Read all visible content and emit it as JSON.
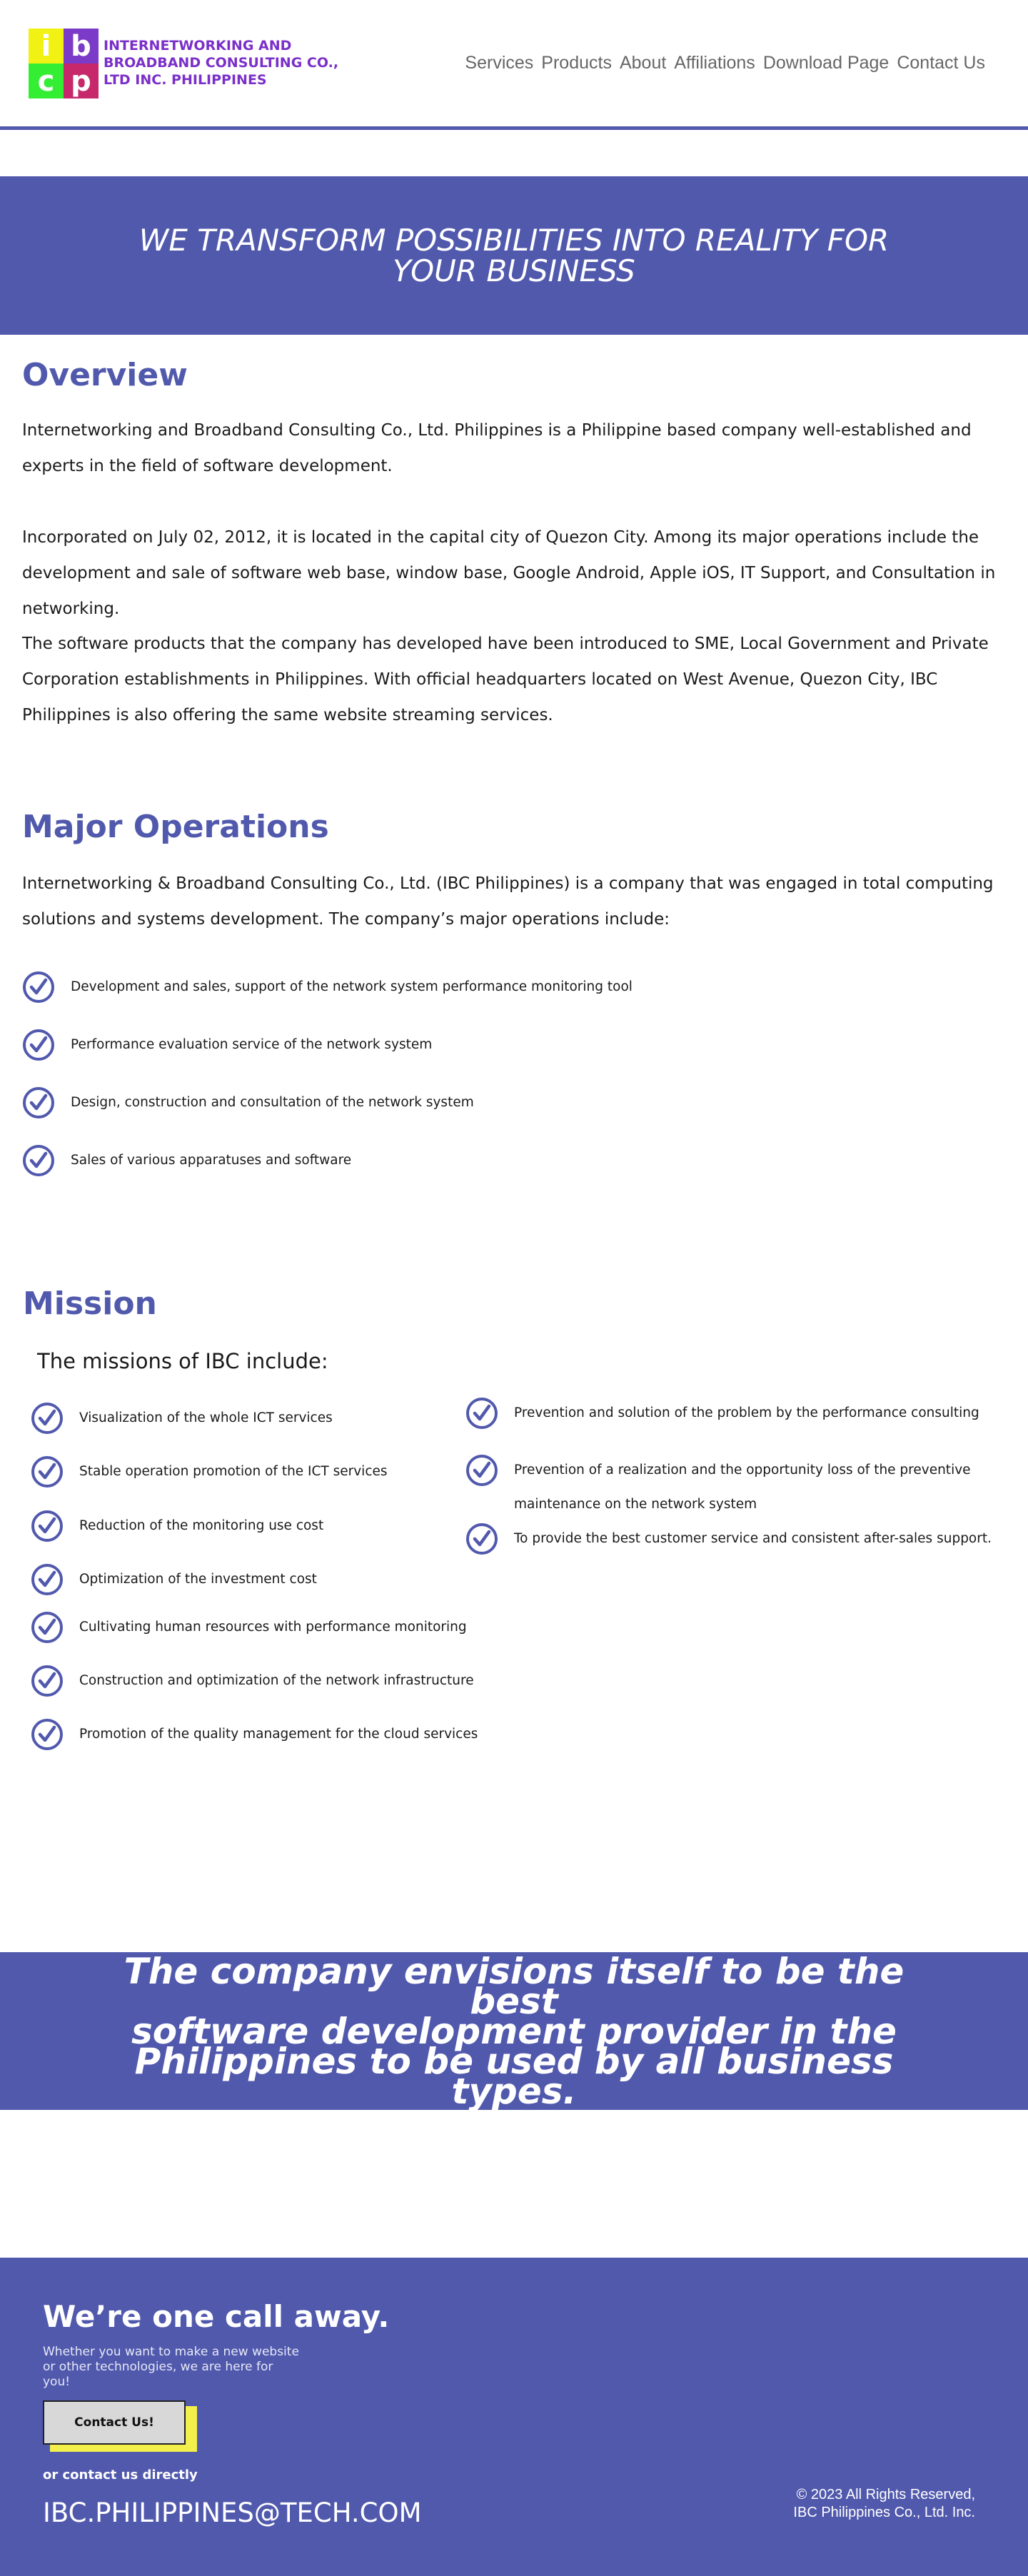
{
  "header": {
    "logo_letters": [
      "i",
      "b",
      "c",
      "p"
    ],
    "company_name_line1": "INTERNETWORKING AND",
    "company_name_line2": "BROADBAND CONSULTING CO.,",
    "company_name_line3": "LTD INC. PHILIPPINES",
    "nav": [
      "Services",
      "Products",
      "About",
      "Affiliations",
      "Download Page",
      "Contact Us"
    ]
  },
  "hero": {
    "line1": "WE TRANSFORM POSSIBILITIES INTO REALITY FOR",
    "line2": "YOUR BUSINESS"
  },
  "overview": {
    "title": "Overview",
    "p1": "Internetworking and Broadband Consulting Co., Ltd. Philippines is a Philippine based company well-established and experts in the field of software development.",
    "p2": "Incorporated on July 02, 2012, it is located in the capital city of Quezon City. Among its major operations include the development and sale of software web base, window base, Google Android, Apple iOS, IT Support, and Consultation in networking.",
    "p3": "The software products that the company has developed have been introduced to SME, Local Government and Private Corporation establishments in Philippines. With official headquarters located on West Avenue, Quezon City, IBC Philippines is also offering the same website streaming services."
  },
  "operations": {
    "title": "Major Operations",
    "intro": "Internetworking & Broadband Consulting Co., Ltd. (IBC Philippines) is a company that was engaged in total computing solutions and systems development. The company’s major operations include:",
    "items": [
      "Development and sales, support of the network system performance monitoring tool",
      "Performance evaluation service of the network system",
      "Design, construction and consultation of the network system",
      "Sales of various apparatuses and software"
    ]
  },
  "mission": {
    "title": "Mission",
    "subtitle": "The missions of IBC include:",
    "left_items": [
      "Visualization of the whole ICT services",
      "Stable operation promotion of the ICT services",
      "Reduction of the monitoring use cost",
      "Optimization of the investment cost",
      "Cultivating human resources with performance monitoring",
      "Construction and optimization of the network infrastructure",
      "Promotion of the quality management for the cloud services"
    ],
    "right_items": [
      "Prevention and solution of the problem by the performance consulting",
      "Prevention of a realization and the opportunity loss of the preventive maintenance on the network system",
      "To provide the best customer service and consistent after-sales support."
    ]
  },
  "vision": {
    "line1": "The company envisions itself to be the best",
    "line2": "software development provider in the",
    "line3": "Philippines to be used by all business types."
  },
  "footer": {
    "title": "We’re one call away.",
    "description": "Whether you want to make a new website or other technologies, we are here for you!",
    "button_label": "Contact Us!",
    "or_contact": "or contact us directly",
    "email": "IBC.PHILIPPINES@TECH.COM",
    "copyright_line1": "© 2023 All Rights Reserved,",
    "copyright_line2": "IBC Philippines Co., Ltd. Inc."
  },
  "colors": {
    "accent": "#5159ad",
    "logo_i": "#f1f114",
    "logo_b": "#7b3ac7",
    "logo_c": "#33ee33",
    "logo_p": "#c7286b",
    "company_name": "#7a2fc9",
    "button_shadow": "#f3ef4b"
  },
  "icons": {
    "check": "check-circle-icon"
  }
}
